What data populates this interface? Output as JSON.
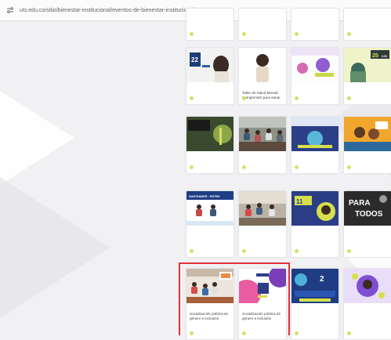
{
  "browser": {
    "url": "uts.edu.co/sitio/bienestar-institucional/eventos-de-bienestar-institucional/"
  },
  "cards": [
    {
      "category": "",
      "title": "",
      "date": ""
    },
    {
      "category": "",
      "title": "",
      "date": ""
    },
    {
      "category": "",
      "title": "",
      "date": ""
    },
    {
      "category": "",
      "title": "",
      "date": ""
    },
    {
      "category": "",
      "title": "",
      "date": "",
      "thumb_text": "22"
    },
    {
      "category": "",
      "title": "Taller de Salud Mental: Comprender para sanar",
      "date": ""
    },
    {
      "category": "",
      "title": "",
      "date": ""
    },
    {
      "category": "",
      "title": "",
      "date": "",
      "thumb_text": "25|3:00"
    },
    {
      "category": "",
      "title": "",
      "date": ""
    },
    {
      "category": "",
      "title": "",
      "date": ""
    },
    {
      "category": "",
      "title": "",
      "date": ""
    },
    {
      "category": "",
      "title": "",
      "date": ""
    },
    {
      "category": "",
      "title": "",
      "date": "",
      "thumb_text": "SANTANDER · EDTEK"
    },
    {
      "category": "",
      "title": "",
      "date": ""
    },
    {
      "category": "",
      "title": "",
      "date": "",
      "thumb_text": "11"
    },
    {
      "category": "",
      "title": "",
      "date": "",
      "thumb_text": "PARA TODOS"
    },
    {
      "category": "",
      "title": "Socialización política de género e inclusión",
      "date": ""
    },
    {
      "category": "",
      "title": "Socialización política de género e inclusión",
      "date": ""
    },
    {
      "category": "",
      "title": "",
      "date": "",
      "thumb_text": "2"
    },
    {
      "category": "",
      "title": "",
      "date": ""
    }
  ]
}
